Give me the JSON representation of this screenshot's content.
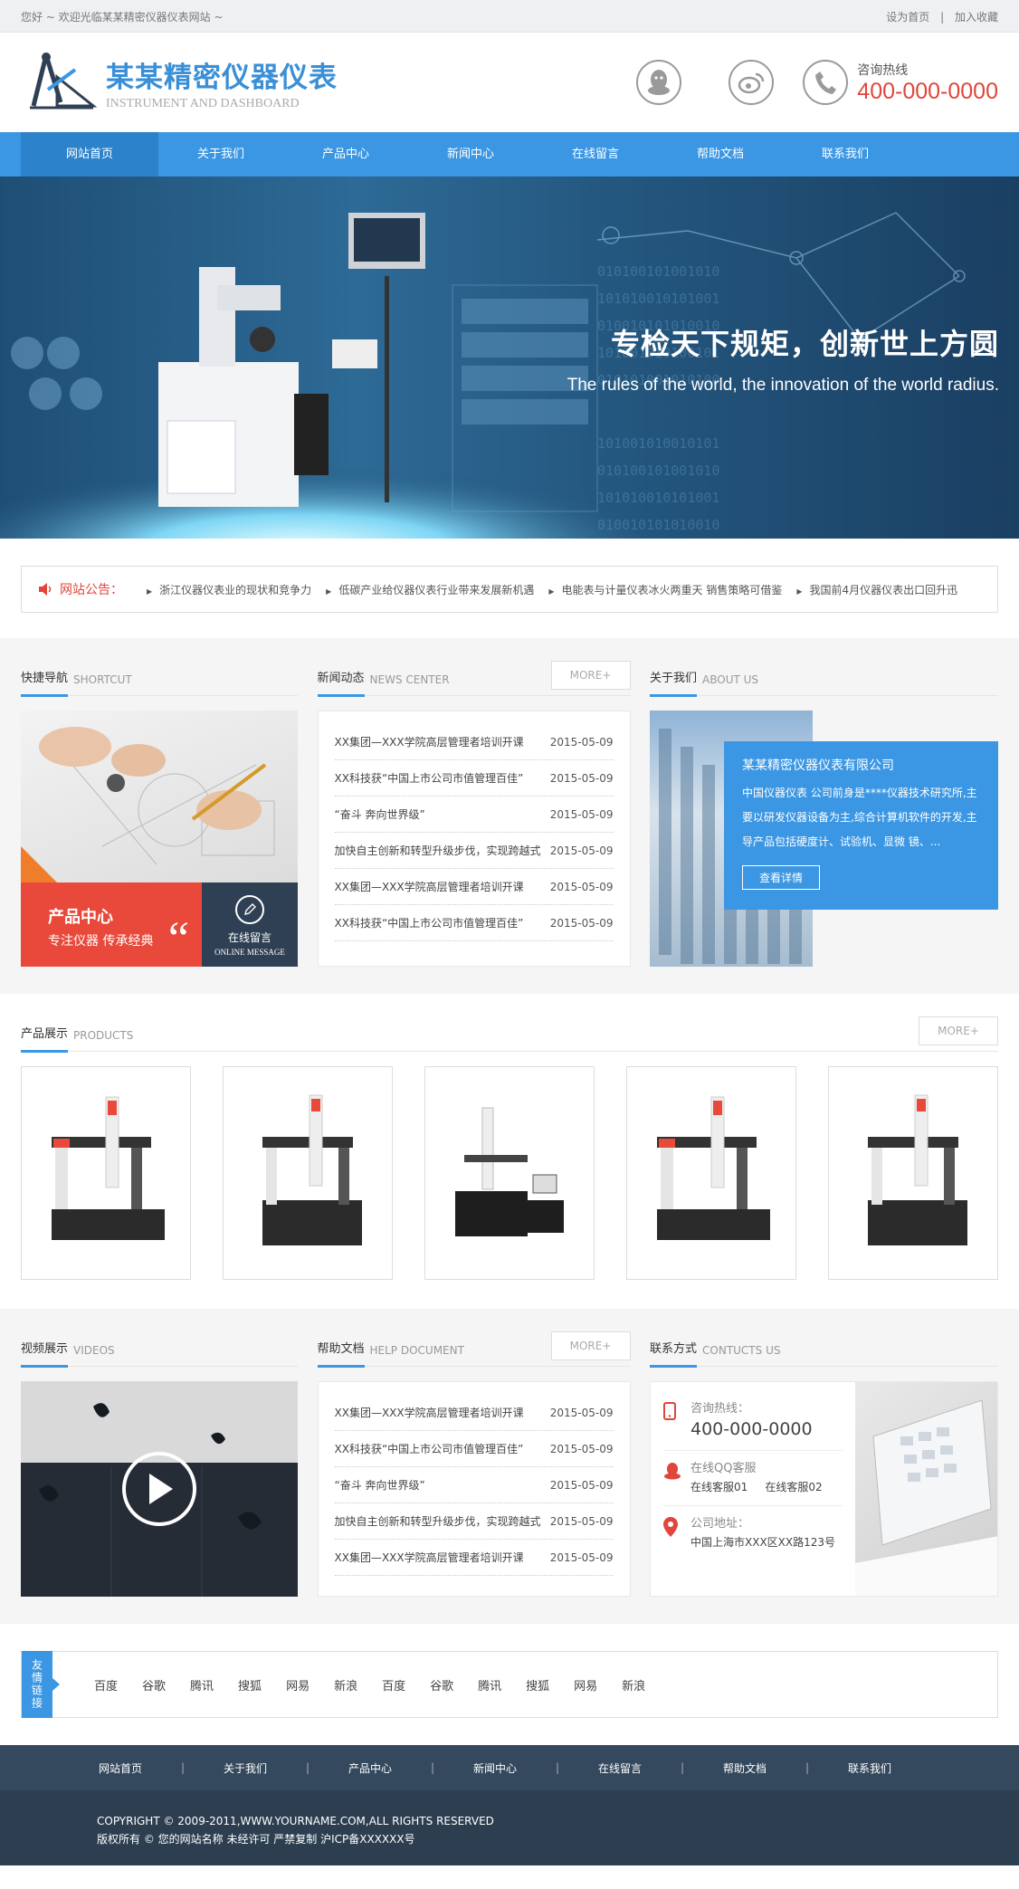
{
  "topbar": {
    "welcome": "您好 ~ 欢迎光临某某精密仪器仪表网站 ~",
    "set_home": "设为首页",
    "sep": "|",
    "favorite": "加入收藏"
  },
  "header": {
    "logo_cn": "某某精密仪器仪表",
    "logo_en": "INSTRUMENT AND DASHBOARD",
    "hotline_label": "咨询热线",
    "hotline_number": "400-000-0000"
  },
  "nav": [
    "网站首页",
    "关于我们",
    "产品中心",
    "新闻中心",
    "在线留言",
    "帮助文档",
    "联系我们"
  ],
  "banner": {
    "title": "专检天下规矩，创新世上方圆",
    "subtitle": "The rules of the world, the innovation of the world radius."
  },
  "notice": {
    "label": "网站公告：",
    "items": [
      "浙江仪器仪表业的现状和竞争力",
      "低碳产业给仪器仪表行业带来发展新机遇",
      "电能表与计量仪表冰火两重天 销售策略可借鉴",
      "我国前4月仪器仪表出口回升迅"
    ]
  },
  "shortcut": {
    "title_cn": "快捷导航",
    "title_en": "SHORTCUT",
    "product_title": "产品中心",
    "product_sub": "专注仪器 传承经典",
    "quote": "“",
    "message_cn": "在线留言",
    "message_en": "ONLINE MESSAGE"
  },
  "news": {
    "title_cn": "新闻动态",
    "title_en": "NEWS CENTER",
    "more": "MORE+",
    "items": [
      {
        "title": "XX集团—XXX学院高层管理者培训开课",
        "date": "2015-05-09"
      },
      {
        "title": "XX科技获“中国上市公司市值管理百佳”",
        "date": "2015-05-09"
      },
      {
        "title": "“奋斗 奔向世界级”",
        "date": "2015-05-09"
      },
      {
        "title": "加快自主创新和转型升级步伐，实现跨越式",
        "date": "2015-05-09"
      },
      {
        "title": "XX集团—XXX学院高层管理者培训开课",
        "date": "2015-05-09"
      },
      {
        "title": "XX科技获“中国上市公司市值管理百佳”",
        "date": "2015-05-09"
      }
    ]
  },
  "about": {
    "title_cn": "关于我们",
    "title_en": "ABOUT US",
    "company": "某某精密仪器仪表有限公司",
    "desc": "中国仪器仪表 公司前身是****仪器技术研究所,主要以研发仪器设备为主,综合计算机软件的开发,主导产品包括硬度计、试验机、显微 镜、...",
    "button": "查看详情"
  },
  "products": {
    "title_cn": "产品展示",
    "title_en": "PRODUCTS",
    "more": "MORE+"
  },
  "videos": {
    "title_cn": "视频展示",
    "title_en": "VIDEOS"
  },
  "help": {
    "title_cn": "帮助文档",
    "title_en": "HELP DOCUMENT",
    "more": "MORE+",
    "items": [
      {
        "title": "XX集团—XXX学院高层管理者培训开课",
        "date": "2015-05-09"
      },
      {
        "title": "XX科技获“中国上市公司市值管理百佳”",
        "date": "2015-05-09"
      },
      {
        "title": "“奋斗 奔向世界级”",
        "date": "2015-05-09"
      },
      {
        "title": "加快自主创新和转型升级步伐，实现跨越式",
        "date": "2015-05-09"
      },
      {
        "title": "XX集团—XXX学院高层管理者培训开课",
        "date": "2015-05-09"
      }
    ]
  },
  "contact": {
    "title_cn": "联系方式",
    "title_en": "CONTUCTS US",
    "phone_label": "咨询热线：",
    "phone": "400-000-0000",
    "qq_label": "在线QQ客服",
    "qq1": "在线客服01",
    "qq2": "在线客服02",
    "addr_label": "公司地址：",
    "addr": "中国上海市XXX区XX路123号"
  },
  "friend_links": {
    "label": "友情链接",
    "items": [
      "百度",
      "谷歌",
      "腾讯",
      "搜狐",
      "网易",
      "新浪",
      "百度",
      "谷歌",
      "腾讯",
      "搜狐",
      "网易",
      "新浪"
    ]
  },
  "footer": {
    "nav": [
      "网站首页",
      "关于我们",
      "产品中心",
      "新闻中心",
      "在线留言",
      "帮助文档",
      "联系我们"
    ],
    "sep": "|",
    "copyright": "COPYRIGHT © 2009-2011,WWW.YOURNAME.COM,ALL RIGHTS RESERVED",
    "icp": "版权所有 © 您的网站名称 未经许可 严禁复制 沪ICP备XXXXXX号"
  },
  "colors": {
    "accent": "#3b97e3",
    "red": "#e8493a",
    "dark": "#2f4054",
    "hot": "#e0463b"
  }
}
